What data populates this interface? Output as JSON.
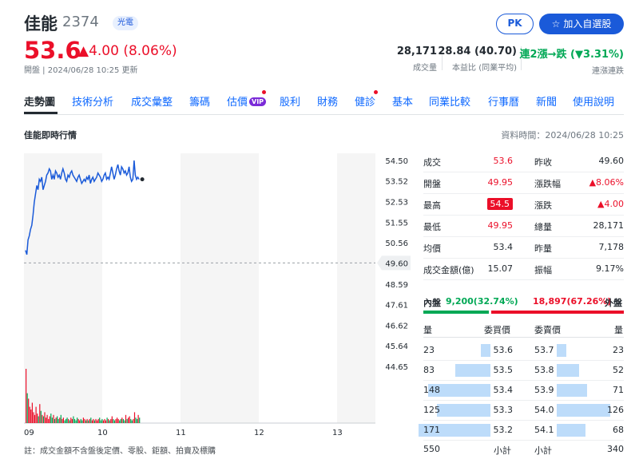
{
  "header": {
    "name": "佳能",
    "code": "2374",
    "badge": "光電",
    "pk_label": "PK",
    "watch_label": "加入自選股",
    "price": "53.6",
    "change": "▲4.00 (8.06%)",
    "meta": "開盤 | 2024/06/28 10:25 更新",
    "stats": [
      {
        "value": "28,171",
        "label": "成交量"
      },
      {
        "value": "28.84 (40.70)",
        "label": "本益比 (同業平均)"
      },
      {
        "value": "連2漲→跌 (▼3.31%)",
        "label": "連漲連跌"
      }
    ]
  },
  "tabs": [
    "走勢圖",
    "技術分析",
    "成交彙整",
    "籌碼",
    "估價",
    "股利",
    "財務",
    "健診",
    "基本",
    "同業比較",
    "行事曆",
    "新聞",
    "使用說明"
  ],
  "vip_label": "VIP",
  "section": {
    "title": "佳能即時行情",
    "time": "資料時間：2024/06/28 10:25"
  },
  "chart_data": {
    "type": "line",
    "title": "",
    "x_ticks": [
      "09",
      "10",
      "11",
      "12",
      "13"
    ],
    "y_ticks": [
      54.5,
      53.52,
      52.53,
      51.55,
      50.56,
      48.59,
      47.61,
      46.62,
      45.64,
      44.65
    ],
    "ylim": [
      44.65,
      54.5
    ],
    "prev_close": 49.6,
    "prev_close_label": "49.60",
    "grid": false,
    "series": [
      {
        "values": [
          50.2,
          50.0,
          50.7,
          50.9,
          51.2,
          51.4,
          51.9,
          52.5,
          52.9,
          53.3,
          53.1,
          53.6,
          53.5,
          53.7,
          53.1,
          53.3,
          53.5,
          53.8,
          53.9,
          54.1,
          54.0,
          53.6,
          53.8,
          53.6,
          54.0,
          53.9,
          53.7,
          53.8,
          53.6,
          53.9,
          54.1,
          53.9,
          53.6,
          53.5,
          53.8,
          53.7,
          53.9,
          54.0,
          53.8,
          53.7,
          53.6,
          53.5,
          53.7,
          53.8,
          53.6,
          53.4,
          53.5,
          53.6,
          53.5,
          53.7,
          53.6,
          53.8,
          53.4,
          53.6,
          53.7,
          53.5,
          53.6,
          53.7,
          53.9,
          53.8,
          53.7,
          53.5,
          53.6,
          53.8,
          53.9,
          53.6,
          53.7,
          53.6,
          53.9,
          54.2,
          53.9,
          53.6,
          53.8,
          54.1,
          54.3,
          54.0,
          53.8,
          54.2,
          54.1,
          53.9,
          54.0,
          53.8,
          53.9,
          54.2,
          53.7,
          53.5,
          53.6,
          54.5,
          53.8,
          53.6,
          53.7,
          53.6
        ]
      }
    ],
    "volume": [
      40,
      22,
      18,
      12,
      10,
      15,
      8,
      6,
      12,
      7,
      5,
      14,
      9,
      6,
      5,
      8,
      4,
      6,
      3,
      5,
      7,
      4,
      6,
      3,
      4,
      5,
      3,
      4,
      6,
      3,
      4,
      2,
      3,
      4,
      3,
      2,
      4,
      3,
      5,
      3,
      2,
      4,
      3,
      2,
      3,
      2,
      4,
      3,
      2,
      3,
      2,
      3,
      4,
      2,
      3,
      2,
      3,
      2,
      3,
      4,
      2,
      3,
      2,
      3,
      2,
      4,
      3,
      2,
      3,
      5,
      3,
      2,
      3,
      4,
      3,
      2,
      3,
      4,
      3,
      2,
      6,
      3,
      4,
      5,
      3,
      2,
      3,
      8,
      4,
      3,
      6,
      4
    ],
    "last_dot": 53.6
  },
  "quote": {
    "left": [
      {
        "k": "成交",
        "v": "53.6",
        "color": "red",
        "hl": false
      },
      {
        "k": "開盤",
        "v": "49.95",
        "color": "red",
        "hl": false
      },
      {
        "k": "最高",
        "v": "54.5",
        "color": "red",
        "hl": true
      },
      {
        "k": "最低",
        "v": "49.95",
        "color": "red",
        "hl": false
      },
      {
        "k": "均價",
        "v": "53.4",
        "color": "dark",
        "hl": false
      },
      {
        "k": "成交金額(億)",
        "v": "15.07",
        "color": "dark",
        "hl": false
      }
    ],
    "right": [
      {
        "k": "昨收",
        "v": "49.60",
        "color": "dark"
      },
      {
        "k": "漲跌幅",
        "v": "▲8.06%",
        "color": "red"
      },
      {
        "k": "漲跌",
        "v": "▲4.00",
        "color": "red"
      },
      {
        "k": "總量",
        "v": "28,171",
        "color": "dark"
      },
      {
        "k": "昨量",
        "v": "7,178",
        "color": "dark"
      },
      {
        "k": "振幅",
        "v": "9.17%",
        "color": "dark"
      }
    ]
  },
  "inner_outer": {
    "inner_label": "內盤",
    "inner_value": "9,200(32.74%)",
    "inner_pct": 32.74,
    "outer_value": "18,897(67.26%)",
    "outer_label": "外盤",
    "colors": {
      "inner": "#00a855",
      "outer": "#eb0f29"
    }
  },
  "orderbook": {
    "headers": [
      "量",
      "委買價",
      "委賣價",
      "量"
    ],
    "bids": [
      {
        "qty": "23",
        "price": "53.6",
        "ratio": 0.13
      },
      {
        "qty": "83",
        "price": "53.5",
        "ratio": 0.49
      },
      {
        "qty": "148",
        "price": "53.4",
        "ratio": 0.87
      },
      {
        "qty": "125",
        "price": "53.3",
        "ratio": 0.74
      },
      {
        "qty": "171",
        "price": "53.2",
        "ratio": 1.0
      }
    ],
    "asks": [
      {
        "price": "53.7",
        "qty": "23",
        "ratio": 0.13
      },
      {
        "price": "53.8",
        "qty": "52",
        "ratio": 0.31
      },
      {
        "price": "53.9",
        "qty": "71",
        "ratio": 0.42
      },
      {
        "price": "54.0",
        "qty": "126",
        "ratio": 0.74
      },
      {
        "price": "54.1",
        "qty": "68",
        "ratio": 0.4
      }
    ],
    "bid_total": "550",
    "bid_total_label": "小計",
    "ask_total_label": "小計",
    "ask_total": "340"
  },
  "note": "註：成交金額不含盤後定價、零股、鉅額、拍賣及標購"
}
